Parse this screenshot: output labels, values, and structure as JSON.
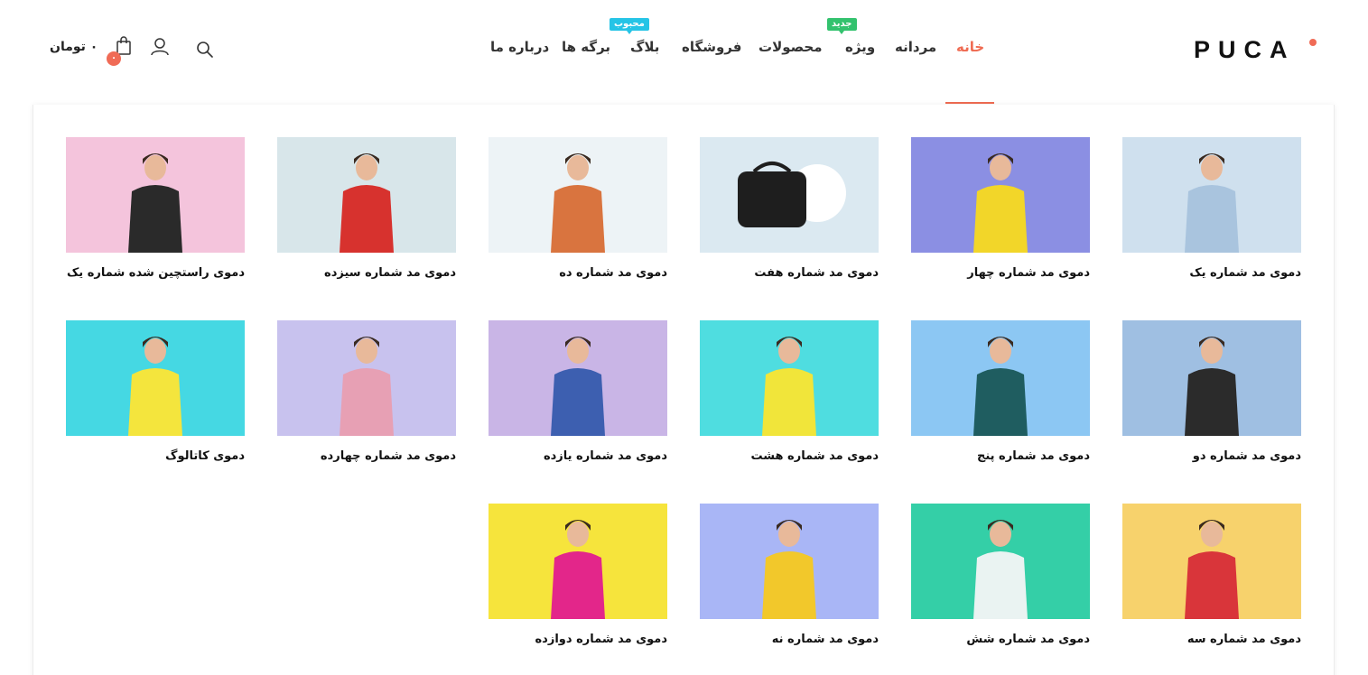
{
  "header": {
    "logo": "PUCA",
    "nav": [
      {
        "label": "خانه",
        "active": true
      },
      {
        "label": "مردانه"
      },
      {
        "label": "ویژه",
        "badge": "جدید"
      },
      {
        "label": "محصولات"
      },
      {
        "label": "فروشگاه"
      },
      {
        "label": "بلاگ",
        "badge": "محبوب"
      },
      {
        "label": "برگه ها"
      },
      {
        "label": "درباره ما"
      }
    ],
    "cart_count": "۰",
    "cart_total": "۰ تومان"
  },
  "demos": [
    {
      "label": "دموی مد شماره یک",
      "bg": "#cfe0ee",
      "accent": "#a9c4de"
    },
    {
      "label": "دموی مد شماره چهار",
      "bg": "#8b8fe3",
      "accent": "#f2d629"
    },
    {
      "label": "دموی مد شماره هفت",
      "bg": "#dbe9f1",
      "accent": "#1e1e1e"
    },
    {
      "label": "دموی مد شماره ده",
      "bg": "#edf3f6",
      "accent": "#d9743f"
    },
    {
      "label": "دموی مد شماره سیزده",
      "bg": "#d8e6ea",
      "accent": "#d7322e"
    },
    {
      "label": "دموی راستچین شده شماره یک",
      "bg": "#f4c4dc",
      "accent": "#2a2a2a"
    },
    {
      "label": "دموی مد شماره دو",
      "bg": "#9fbfe2",
      "accent": "#2b2b2b"
    },
    {
      "label": "دموی مد شماره پنج",
      "bg": "#8cc7f3",
      "accent": "#1f5d60"
    },
    {
      "label": "دموی مد شماره هشت",
      "bg": "#4fdde0",
      "accent": "#f1e53a"
    },
    {
      "label": "دموی مد شماره یازده",
      "bg": "#c9b5e6",
      "accent": "#3d5fb0"
    },
    {
      "label": "دموی مد شماره چهارده",
      "bg": "#c8c2ee",
      "accent": "#e7a0b4"
    },
    {
      "label": "دموی کاتالوگ",
      "bg": "#45d8e3",
      "accent": "#f4e53d"
    },
    {
      "label": "دموی مد شماره سه",
      "bg": "#f7d26c",
      "accent": "#d9353a"
    },
    {
      "label": "دموی مد شماره شش",
      "bg": "#34cfa7",
      "accent": "#eaf3f2"
    },
    {
      "label": "دموی مد شماره نه",
      "bg": "#a9b6f6",
      "accent": "#f2c82b"
    },
    {
      "label": "دموی مد شماره دوازده",
      "bg": "#f6e43c",
      "accent": "#e3268a"
    }
  ]
}
